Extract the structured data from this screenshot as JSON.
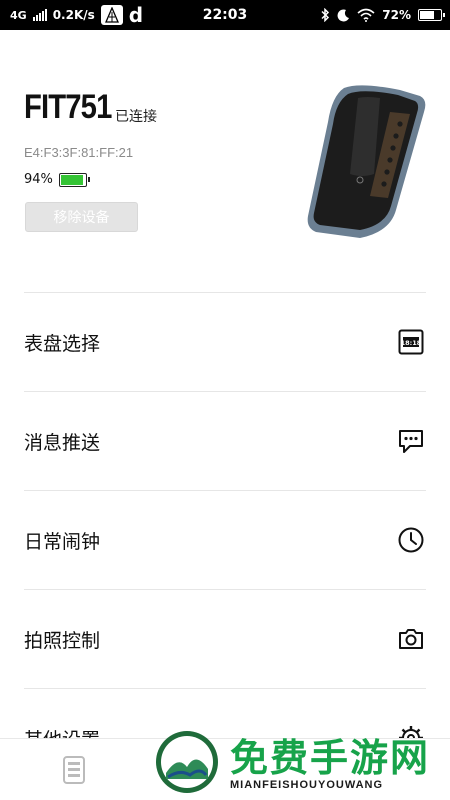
{
  "status_bar": {
    "network": "4G",
    "speed": "0.2K/s",
    "app_glyph": "d",
    "time": "22:03",
    "battery_text": "72%",
    "battery_level": 0.72,
    "icons": [
      "signal-icon",
      "app-icon",
      "bluetooth-icon",
      "moon-icon",
      "wifi-icon",
      "battery-icon"
    ]
  },
  "device": {
    "name": "FIT751",
    "connection_status": "已连接",
    "mac_address": "E4:F3:3F:81:FF:21",
    "battery_text": "94%",
    "battery_level": 0.94,
    "battery_color": "#35c435",
    "remove_label": "移除设备"
  },
  "menu": {
    "items": [
      {
        "label": "表盘选择",
        "icon": "watch-face-icon"
      },
      {
        "label": "消息推送",
        "icon": "message-icon"
      },
      {
        "label": "日常闹钟",
        "icon": "clock-icon"
      },
      {
        "label": "拍照控制",
        "icon": "camera-icon"
      },
      {
        "label": "其他设置",
        "icon": "gear-icon"
      }
    ]
  },
  "bottom_nav": {
    "items": [
      {
        "icon": "device-icon"
      }
    ]
  },
  "watermark": {
    "title": "免费手游网",
    "subtitle": "MIANFEISHOUYOUWANG"
  }
}
